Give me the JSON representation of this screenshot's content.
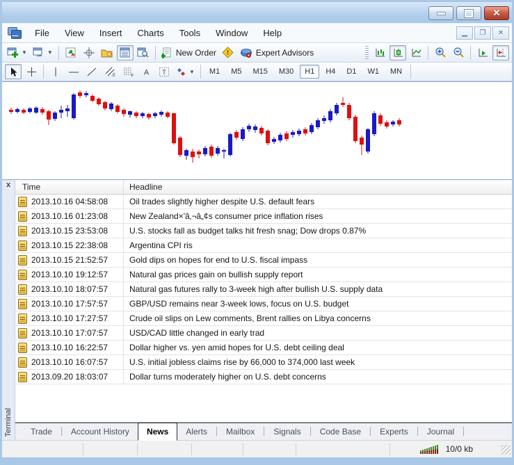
{
  "menu": {
    "items": [
      "File",
      "View",
      "Insert",
      "Charts",
      "Tools",
      "Window",
      "Help"
    ]
  },
  "toolbar": {
    "new_order": "New Order",
    "expert_advisors": "Expert Advisors"
  },
  "timeframes": [
    {
      "label": "M1",
      "active": false
    },
    {
      "label": "M5",
      "active": false
    },
    {
      "label": "M15",
      "active": false
    },
    {
      "label": "M30",
      "active": false
    },
    {
      "label": "H1",
      "active": true
    },
    {
      "label": "H4",
      "active": false
    },
    {
      "label": "D1",
      "active": false
    },
    {
      "label": "W1",
      "active": false
    },
    {
      "label": "MN",
      "active": false
    }
  ],
  "chart_data": {
    "type": "candlestick",
    "background": "#ffffff",
    "up_color": "#1a1ac8",
    "down_color": "#dd1010",
    "note": "candles as [x, dir(u=blue up,d=red down), wickTop, bodyTop, bodyBottom, wickBottom] in chart px",
    "candles": [
      [
        10,
        "d",
        37,
        40,
        43,
        46
      ],
      [
        19,
        "u",
        37,
        39,
        43,
        45
      ],
      [
        28,
        "d",
        38,
        40,
        44,
        46
      ],
      [
        37,
        "u",
        36,
        38,
        43,
        45
      ],
      [
        46,
        "u",
        35,
        37,
        44,
        46
      ],
      [
        55,
        "d",
        36,
        39,
        44,
        47
      ],
      [
        64,
        "d",
        40,
        42,
        54,
        62
      ],
      [
        73,
        "u",
        42,
        44,
        53,
        56
      ],
      [
        82,
        "u",
        34,
        40,
        44,
        52
      ],
      [
        91,
        "u",
        33,
        38,
        42,
        50
      ],
      [
        100,
        "u",
        16,
        18,
        52,
        54
      ],
      [
        109,
        "d",
        12,
        15,
        20,
        23
      ],
      [
        118,
        "u",
        13,
        16,
        19,
        22
      ],
      [
        127,
        "d",
        18,
        20,
        27,
        29
      ],
      [
        136,
        "d",
        22,
        24,
        32,
        34
      ],
      [
        145,
        "d",
        27,
        29,
        38,
        41
      ],
      [
        154,
        "u",
        29,
        31,
        39,
        42
      ],
      [
        163,
        "d",
        32,
        34,
        43,
        45
      ],
      [
        172,
        "d",
        38,
        40,
        46,
        50
      ],
      [
        181,
        "u",
        41,
        42,
        47,
        51
      ],
      [
        190,
        "d",
        42,
        44,
        49,
        52
      ],
      [
        199,
        "u",
        43,
        45,
        49,
        52
      ],
      [
        208,
        "d",
        44,
        46,
        51,
        54
      ],
      [
        217,
        "u",
        43,
        45,
        49,
        52
      ],
      [
        226,
        "u",
        41,
        43,
        47,
        50
      ],
      [
        235,
        "d",
        42,
        44,
        50,
        52
      ],
      [
        244,
        "d",
        44,
        45,
        88,
        90
      ],
      [
        253,
        "d",
        78,
        80,
        105,
        108
      ],
      [
        262,
        "u",
        96,
        98,
        106,
        112
      ],
      [
        271,
        "d",
        96,
        100,
        108,
        116
      ],
      [
        280,
        "d",
        97,
        100,
        104,
        110
      ],
      [
        289,
        "u",
        92,
        95,
        104,
        107
      ],
      [
        298,
        "d",
        90,
        93,
        106,
        109
      ],
      [
        307,
        "u",
        92,
        95,
        103,
        106
      ],
      [
        316,
        "u",
        96,
        98,
        100,
        110
      ],
      [
        325,
        "u",
        73,
        75,
        105,
        107
      ],
      [
        334,
        "d",
        69,
        72,
        80,
        83
      ],
      [
        343,
        "u",
        65,
        68,
        82,
        85
      ],
      [
        352,
        "u",
        60,
        63,
        68,
        72
      ],
      [
        361,
        "u",
        61,
        64,
        69,
        73
      ],
      [
        370,
        "d",
        63,
        66,
        74,
        77
      ],
      [
        379,
        "d",
        68,
        70,
        88,
        91
      ],
      [
        388,
        "u",
        79,
        82,
        86,
        89
      ],
      [
        397,
        "u",
        73,
        76,
        84,
        87
      ],
      [
        406,
        "d",
        71,
        74,
        82,
        85
      ],
      [
        415,
        "u",
        69,
        72,
        76,
        80
      ],
      [
        424,
        "u",
        67,
        70,
        75,
        78
      ],
      [
        433,
        "d",
        65,
        68,
        74,
        77
      ],
      [
        442,
        "u",
        59,
        62,
        72,
        75
      ],
      [
        451,
        "u",
        52,
        55,
        65,
        68
      ],
      [
        460,
        "u",
        48,
        52,
        56,
        60
      ],
      [
        469,
        "u",
        39,
        42,
        55,
        58
      ],
      [
        478,
        "u",
        30,
        33,
        45,
        48
      ],
      [
        487,
        "d",
        22,
        30,
        33,
        36
      ],
      [
        496,
        "d",
        30,
        33,
        52,
        55
      ],
      [
        505,
        "d",
        47,
        50,
        85,
        88
      ],
      [
        514,
        "d",
        77,
        80,
        90,
        105
      ],
      [
        523,
        "u",
        66,
        68,
        100,
        103
      ],
      [
        532,
        "u",
        42,
        45,
        75,
        78
      ],
      [
        541,
        "d",
        45,
        48,
        60,
        63
      ],
      [
        550,
        "d",
        55,
        58,
        64,
        67
      ],
      [
        559,
        "u",
        55,
        57,
        61,
        64
      ],
      [
        568,
        "d",
        52,
        55,
        61,
        64
      ]
    ]
  },
  "terminal": {
    "label": "Terminal",
    "close": "x",
    "columns": [
      "Time",
      "Headline"
    ],
    "rows": [
      {
        "time": "2013.10.16 04:58:08",
        "headline": "Oil trades slightly higher despite U.S. default fears"
      },
      {
        "time": "2013.10.16 01:23:08",
        "headline": "New Zealand×'â‚¬â„¢s consumer price inflation rises"
      },
      {
        "time": "2013.10.15 23:53:08",
        "headline": "U.S. stocks fall as budget talks hit fresh snag; Dow drops 0.87%"
      },
      {
        "time": "2013.10.15 22:38:08",
        "headline": "Argentina CPI ris"
      },
      {
        "time": "2013.10.15 21:52:57",
        "headline": "Gold dips on hopes for end to U.S. fiscal impass"
      },
      {
        "time": "2013.10.10 19:12:57",
        "headline": "Natural gas prices gain on bullish supply report"
      },
      {
        "time": "2013.10.10 18:07:57",
        "headline": "Natural gas futures rally to 3-week high after bullish U.S. supply data"
      },
      {
        "time": "2013.10.10 17:57:57",
        "headline": "GBP/USD remains near 3-week lows, focus on U.S. budget"
      },
      {
        "time": "2013.10.10 17:27:57",
        "headline": "Crude oil slips on Lew comments, Brent rallies on Libya concerns"
      },
      {
        "time": "2013.10.10 17:07:57",
        "headline": "USD/CAD little changed in early trad"
      },
      {
        "time": "2013.10.10 16:22:57",
        "headline": "Dollar higher vs. yen amid hopes for U.S. debt ceiling deal"
      },
      {
        "time": "2013.10.10 16:07:57",
        "headline": "U.S. initial jobless claims rise by 66,000 to 374,000 last week"
      },
      {
        "time": "2013.09.20 18:03:07",
        "headline": "Dollar turns moderately higher on U.S. debt concerns"
      }
    ]
  },
  "tabs": [
    {
      "label": "Trade",
      "active": false
    },
    {
      "label": "Account History",
      "active": false
    },
    {
      "label": "News",
      "active": true
    },
    {
      "label": "Alerts",
      "active": false
    },
    {
      "label": "Mailbox",
      "active": false
    },
    {
      "label": "Signals",
      "active": false
    },
    {
      "label": "Code Base",
      "active": false
    },
    {
      "label": "Experts",
      "active": false
    },
    {
      "label": "Journal",
      "active": false
    }
  ],
  "status": {
    "traffic": "10/0 kb"
  }
}
